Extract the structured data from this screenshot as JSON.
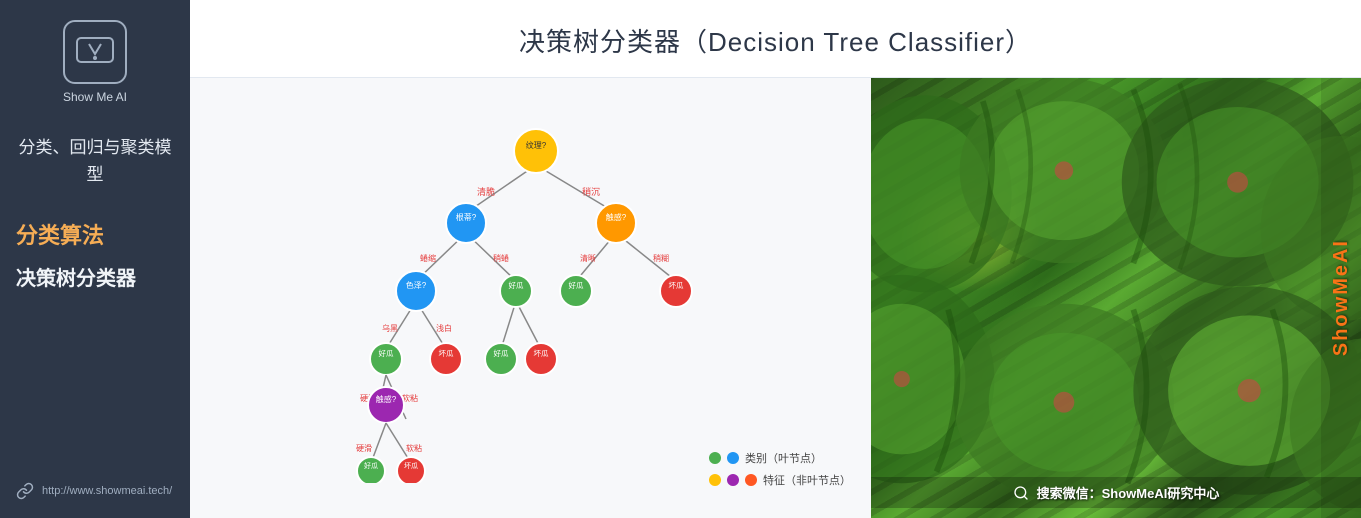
{
  "sidebar": {
    "logo_alt": "ShowMeAI Logo",
    "logo_text": "Show Me AI",
    "subtitle": "分类、回归与聚类模型",
    "section_label": "分类算法",
    "item_label": "决策树分类器",
    "footer_link": "http://www.showmeai.tech/"
  },
  "slide": {
    "title": "决策树分类器（Decision Tree Classifier）",
    "watermark": "ShowMeAI",
    "watermelon_footer": "搜索微信：ShowMeAI研究中心"
  },
  "legend": {
    "title1": "类别（叶节点）",
    "title2": "特征（非叶节点）",
    "colors": {
      "green": "#4caf50",
      "blue": "#2196f3",
      "yellow": "#ffc107",
      "purple": "#9c27b0",
      "orange": "#ff5722"
    }
  }
}
